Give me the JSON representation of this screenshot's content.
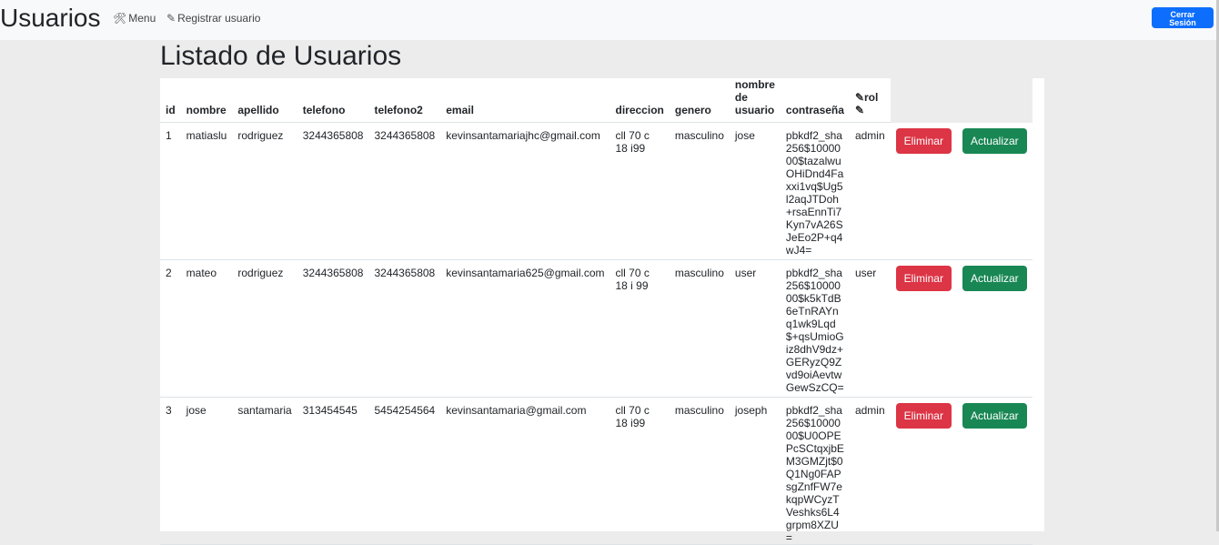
{
  "header": {
    "brand": "Usuarios",
    "menu_label": "Menu",
    "register_label": "Registrar usuario",
    "logout_label": "Cerrar\nSesión"
  },
  "page": {
    "title": "Listado de Usuarios"
  },
  "table": {
    "columns": [
      "id",
      "nombre",
      "apellido",
      "telefono",
      "telefono2",
      "email",
      "direccion",
      "genero",
      "nombre de usuario",
      "contraseña",
      "rol"
    ],
    "rows": [
      {
        "id": "1",
        "nombre": "matiaslu",
        "apellido": "rodriguez",
        "telefono": "3244365808",
        "telefono2": "3244365808",
        "email": "kevinsantamariajhc@gmail.com",
        "direccion": "cll 70 c 18 i99",
        "genero": "masculino",
        "usuario": "jose",
        "contrasena": "pbkdf2_sha256$1000000$tazalwuOHiDnd4Faxxi1vq$Ug5l2aqJTDoh+rsaEnnTi7Kyn7vA26SJeEo2P+q4wJ4=",
        "rol": "admin"
      },
      {
        "id": "2",
        "nombre": "mateo",
        "apellido": "rodriguez",
        "telefono": "3244365808",
        "telefono2": "3244365808",
        "email": "kevinsantamaria625@gmail.com",
        "direccion": "cll 70 c 18 i 99",
        "genero": "masculino",
        "usuario": "user",
        "contrasena": "pbkdf2_sha256$1000000$k5kTdB6eTnRAYnq1wk9Lqd$+qsUmioGiz8dhV9dz+GERyzQ9Zvd9oiAevtwGewSzCQ=",
        "rol": "user"
      },
      {
        "id": "3",
        "nombre": "jose",
        "apellido": "santamaria",
        "telefono": "313454545",
        "telefono2": "5454254564",
        "email": "kevinsantamaria@gmail.com",
        "direccion": "cll 70 c 18 i99",
        "genero": "masculino",
        "usuario": "joseph",
        "contrasena": "pbkdf2_sha256$1000000$U0OPEPcSCtqxjbEM3GMZjt$0Q1Ng0FAPsgZnfFW7ekqpWCyzTVeshks6L4grpm8XZU=",
        "rol": "admin"
      }
    ],
    "delete_label": "Eliminar",
    "update_label": "Actualizar"
  },
  "colors": {
    "primary": "#0d6efd",
    "danger": "#dc3545",
    "success": "#198754"
  },
  "icons": {
    "menu": "tools-icon",
    "register": "pencil-icon",
    "rol": "pencil-icon"
  }
}
